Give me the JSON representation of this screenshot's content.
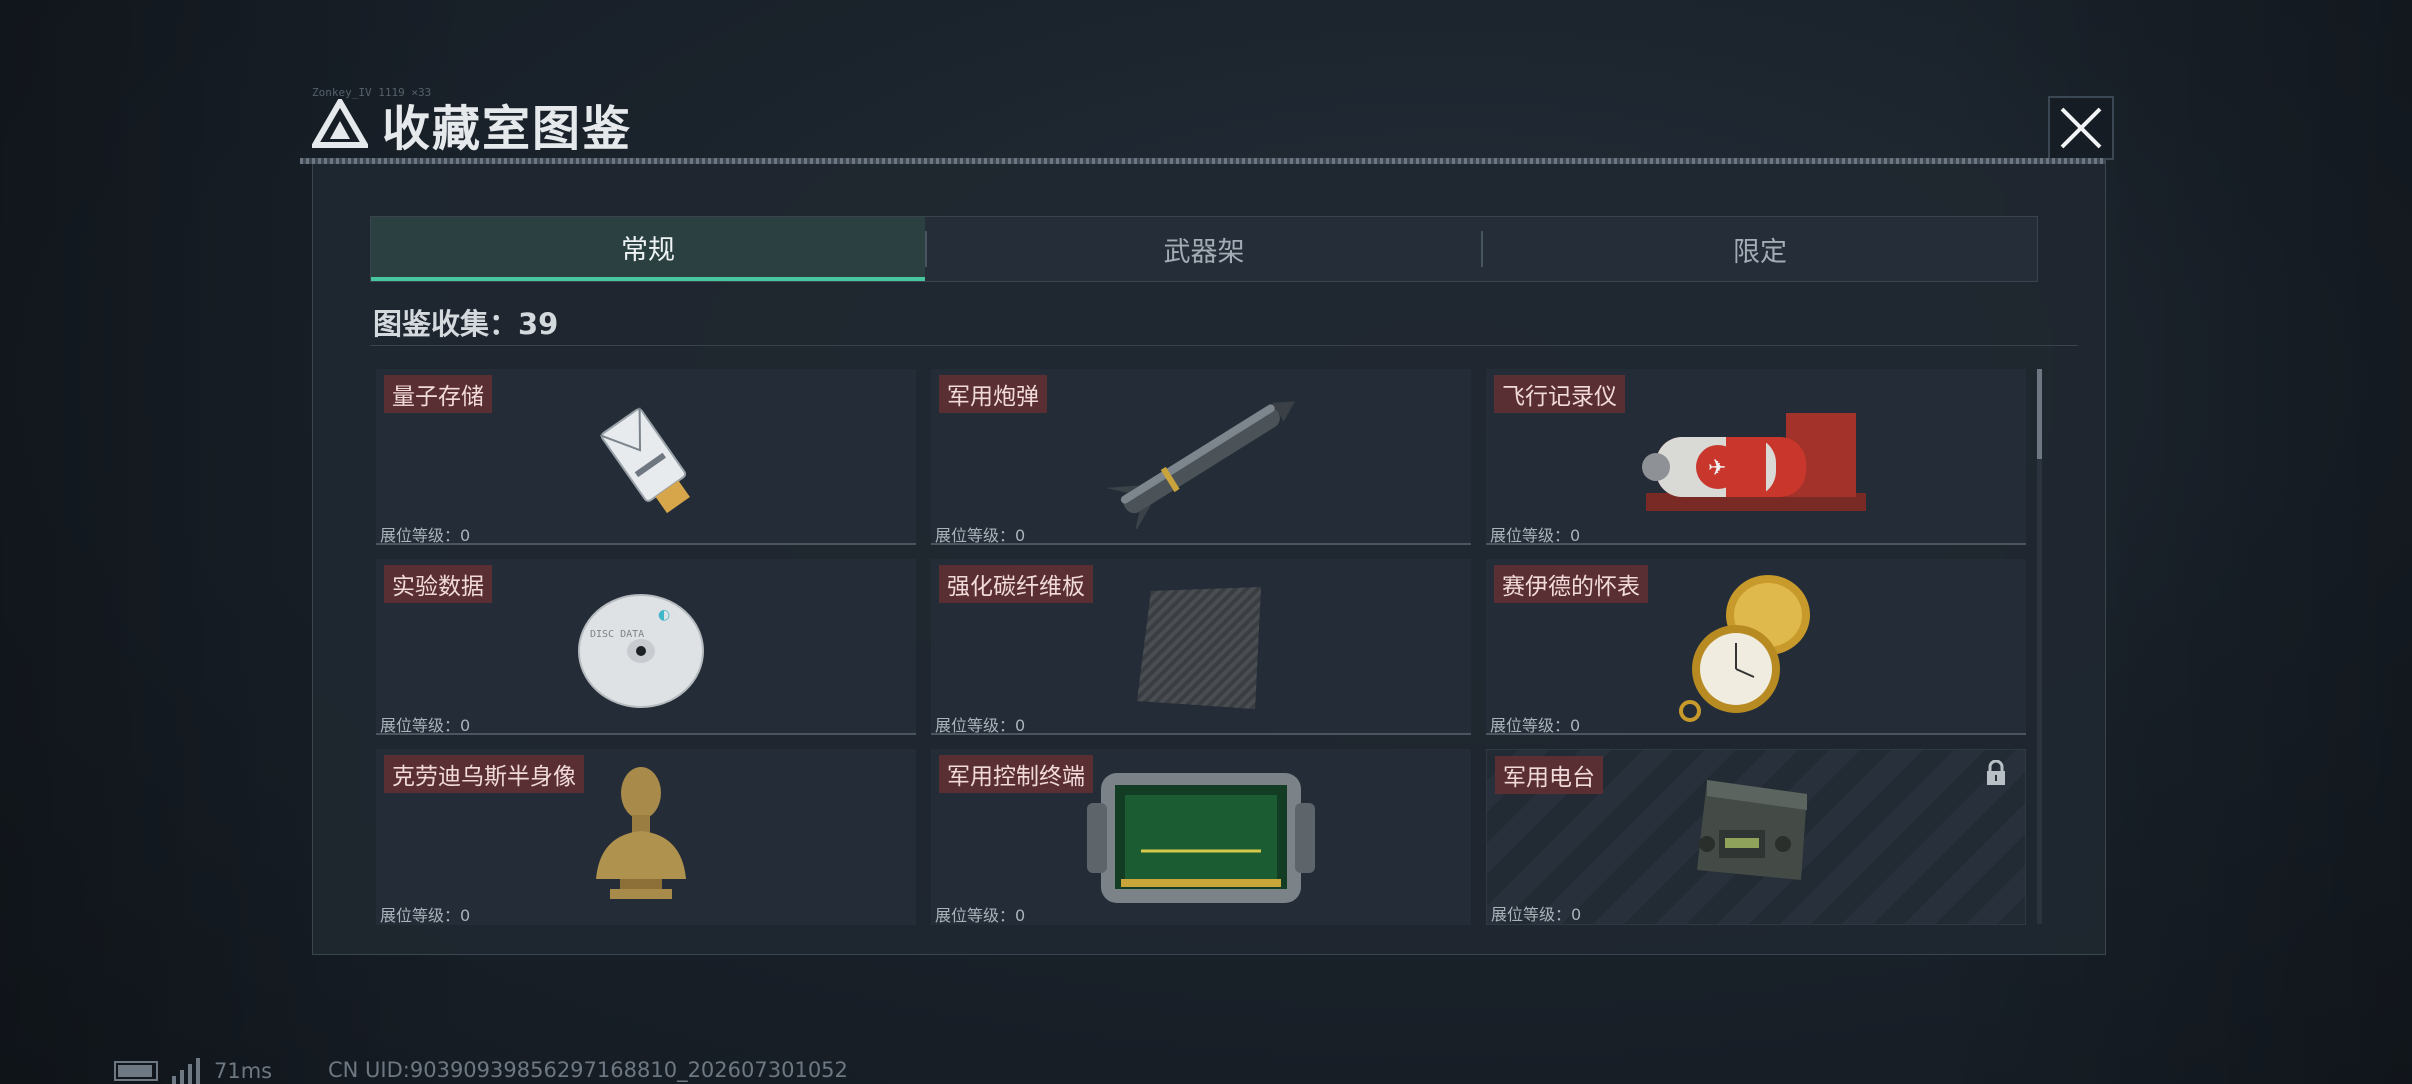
{
  "header": {
    "small_text": "Zonkey_IV 1119 ×33",
    "title": "收藏室图鉴",
    "close_icon": "close-icon",
    "title_icon": "triangle-logo-icon"
  },
  "tabs": [
    {
      "label": "常规",
      "active": true
    },
    {
      "label": "武器架",
      "active": false
    },
    {
      "label": "限定",
      "active": false
    }
  ],
  "collection": {
    "label": "图鉴收集：39"
  },
  "items": [
    {
      "name": "量子存储",
      "level": "展位等级：0",
      "icon": "usb-drive-icon",
      "locked": false
    },
    {
      "name": "军用炮弹",
      "level": "展位等级：0",
      "icon": "missile-icon",
      "locked": false
    },
    {
      "name": "飞行记录仪",
      "level": "展位等级：0",
      "icon": "flight-recorder-icon",
      "locked": false
    },
    {
      "name": "实验数据",
      "level": "展位等级：0",
      "icon": "cd-disc-icon",
      "locked": false
    },
    {
      "name": "强化碳纤维板",
      "level": "展位等级：0",
      "icon": "carbon-plate-icon",
      "locked": false
    },
    {
      "name": "赛伊德的怀表",
      "level": "展位等级：0",
      "icon": "pocket-watch-icon",
      "locked": false
    },
    {
      "name": "克劳迪乌斯半身像",
      "level": "展位等级：0",
      "icon": "bust-statue-icon",
      "locked": false
    },
    {
      "name": "军用控制终端",
      "level": "展位等级：0",
      "icon": "control-terminal-icon",
      "locked": false
    },
    {
      "name": "军用电台",
      "level": "展位等级：0",
      "icon": "military-radio-icon",
      "locked": true
    }
  ],
  "status_bar": {
    "ping": "71ms",
    "uid": "CN UID:9039093985629716881​0_202607301052"
  },
  "colors": {
    "accent": "#48c79f",
    "label_bg": "#5a2f33",
    "panel_bg": "#1f2730"
  }
}
